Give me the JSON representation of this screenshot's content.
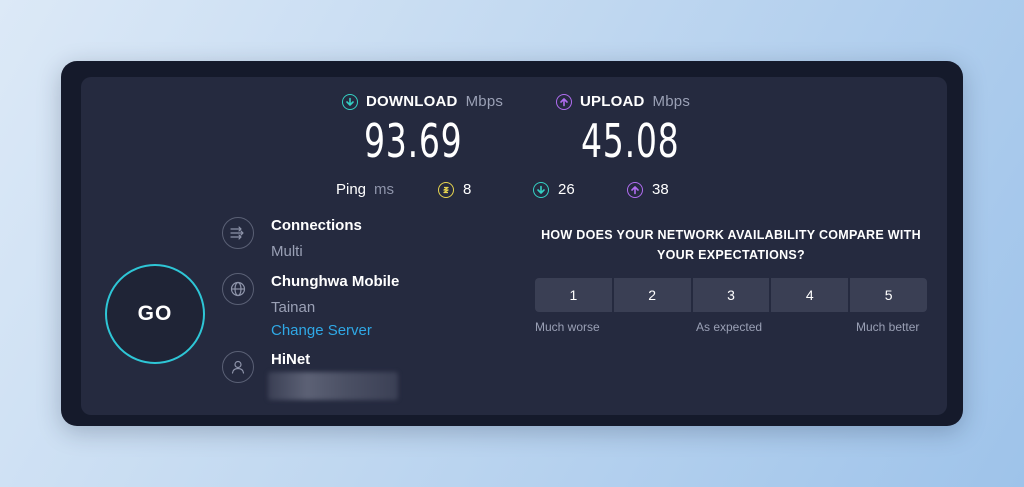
{
  "download": {
    "label": "DOWNLOAD",
    "unit": "Mbps",
    "value": "93.69",
    "icon": "download-arrow-icon",
    "color": "#34d1c4"
  },
  "upload": {
    "label": "UPLOAD",
    "unit": "Mbps",
    "value": "45.08",
    "icon": "upload-arrow-icon",
    "color": "#b06cf0"
  },
  "ping": {
    "label": "Ping",
    "unit": "ms",
    "idle": {
      "value": "8",
      "icon": "jitter-icon",
      "color": "#e6d44f"
    },
    "download": {
      "value": "26",
      "icon": "download-arrow-icon",
      "color": "#34d1c4"
    },
    "upload": {
      "value": "38",
      "icon": "upload-arrow-icon",
      "color": "#b06cf0"
    }
  },
  "go_button": {
    "label": "GO",
    "color": "#2ec6d6"
  },
  "connections": {
    "title": "Connections",
    "value": "Multi",
    "icon": "connections-icon"
  },
  "server": {
    "title": "Chunghwa Mobile",
    "location": "Tainan",
    "change_label": "Change Server",
    "icon": "globe-icon"
  },
  "provider": {
    "title": "HiNet",
    "icon": "user-icon"
  },
  "survey": {
    "question": "HOW DOES YOUR NETWORK AVAILABILITY COMPARE WITH YOUR EXPECTATIONS?",
    "options": [
      "1",
      "2",
      "3",
      "4",
      "5"
    ],
    "low_label": "Much worse",
    "mid_label": "As expected",
    "high_label": "Much better"
  }
}
